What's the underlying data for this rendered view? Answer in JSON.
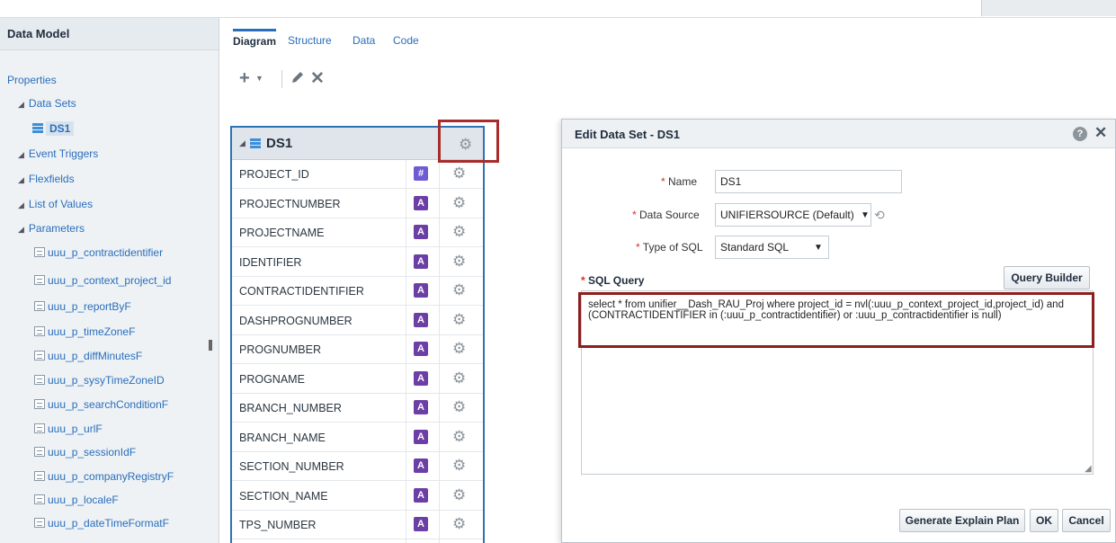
{
  "sidebar": {
    "title": "Data Model",
    "properties": "Properties",
    "data_sets": "Data Sets",
    "ds1": "DS1",
    "event_triggers": "Event Triggers",
    "flexfields": "Flexfields",
    "list_of_values": "List of Values",
    "parameters": "Parameters",
    "param_items": [
      "uuu_p_contractidentifier",
      "uuu_p_context_project_id",
      "uuu_p_reportByF",
      "uuu_p_timeZoneF",
      "uuu_p_diffMinutesF",
      "uuu_p_sysyTimeZoneID",
      "uuu_p_searchConditionF",
      "uuu_p_urlF",
      "uuu_p_sessionIdF",
      "uuu_p_companyRegistryF",
      "uuu_p_localeF",
      "uuu_p_dateTimeFormatF"
    ]
  },
  "tabs": [
    "Diagram",
    "Structure",
    "Data",
    "Code"
  ],
  "dataset": {
    "name": "DS1",
    "rows": [
      {
        "name": "PROJECT_ID",
        "type": "#"
      },
      {
        "name": "PROJECTNUMBER",
        "type": "A"
      },
      {
        "name": "PROJECTNAME",
        "type": "A"
      },
      {
        "name": "IDENTIFIER",
        "type": "A"
      },
      {
        "name": "CONTRACTIDENTIFIER",
        "type": "A"
      },
      {
        "name": "DASHPROGNUMBER",
        "type": "A"
      },
      {
        "name": "PROGNUMBER",
        "type": "A"
      },
      {
        "name": "PROGNAME",
        "type": "A"
      },
      {
        "name": "BRANCH_NUMBER",
        "type": "A"
      },
      {
        "name": "BRANCH_NAME",
        "type": "A"
      },
      {
        "name": "SECTION_NUMBER",
        "type": "A"
      },
      {
        "name": "SECTION_NAME",
        "type": "A"
      },
      {
        "name": "TPS_NUMBER",
        "type": "A"
      }
    ]
  },
  "dialog": {
    "title": "Edit Data Set - DS1",
    "help": "?",
    "close": "✕",
    "name_label": "Name",
    "name_value": "DS1",
    "datasource_label": "Data Source",
    "datasource_value": "UNIFIERSOURCE (Default)",
    "sqltype_label": "Type of SQL",
    "sqltype_value": "Standard SQL",
    "sql_label": "SQL Query",
    "query_builder": "Query Builder",
    "sql_text": "select * from unifier__Dash_RAU_Proj where project_id = nvl(:uuu_p_context_project_id,project_id) and  (CONTRACTIDENTIFIER in (:uuu_p_contractidentifier) or :uuu_p_contractidentifier is null)",
    "explain_plan": "Generate Explain Plan",
    "ok": "OK",
    "cancel": "Cancel",
    "required_mark": "*"
  }
}
